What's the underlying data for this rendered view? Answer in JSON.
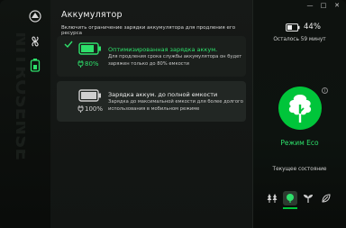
{
  "app": {
    "watermark_text": "NITROSENSE"
  },
  "nav": {
    "items": [
      {
        "name": "logo-icon",
        "active": false
      },
      {
        "name": "fan-icon",
        "active": false
      },
      {
        "name": "battery-icon",
        "active": true
      }
    ]
  },
  "main": {
    "title": "Аккумулятор",
    "subtitle": "Включить ограничение зарядки аккумулятора для продления его ресурса",
    "cards": [
      {
        "title": "Оптимизированная зарядка аккум.",
        "description": "Для продления срока службы аккумулятора он будет заряжен только до 80% емкости",
        "percent": "80%",
        "selected": true,
        "accent": "#2ee06b"
      },
      {
        "title": "Зарядка аккум. до полной емкости",
        "description": "Зарядка до максимальной емкости для более долгого использования в мобильном режиме",
        "percent": "100%",
        "selected": false,
        "accent": "#cfcfcf"
      }
    ]
  },
  "status": {
    "battery_percent": "44%",
    "remaining": "Осталось 59 минут",
    "mode": "Режим Eco",
    "current_state_label": "Текущее состояние",
    "info_icon": "i"
  },
  "window_controls": {
    "minimize": "—",
    "maximize": "□",
    "close": "✕"
  },
  "colors": {
    "accent": "#00c53a",
    "accent_text": "#2ee06b",
    "bg": "#0b0d0b"
  }
}
